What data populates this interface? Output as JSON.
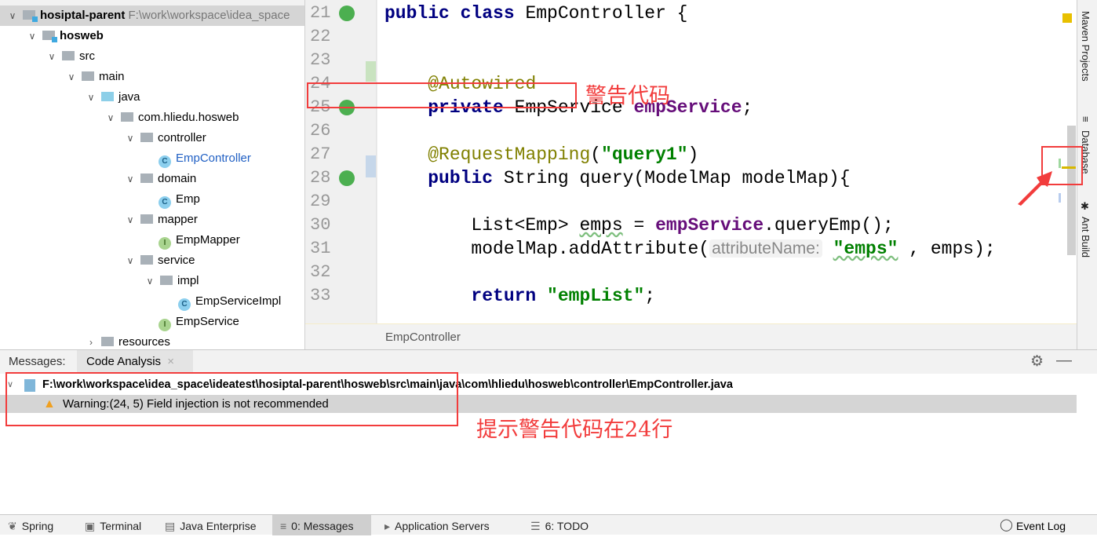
{
  "project": {
    "tree": [
      {
        "label": "hosiptal-parent",
        "path": "F:\\work\\workspace\\idea_space",
        "level": 0,
        "icon": "module-folder-icon",
        "bold": true,
        "selected": true,
        "open": true
      },
      {
        "label": "hosweb",
        "level": 1,
        "icon": "module-folder-icon",
        "bold": true,
        "open": true
      },
      {
        "label": "src",
        "level": 2,
        "icon": "folder-icon",
        "open": true
      },
      {
        "label": "main",
        "level": 3,
        "icon": "folder-icon",
        "open": true
      },
      {
        "label": "java",
        "level": 4,
        "icon": "source-folder-icon",
        "open": true
      },
      {
        "label": "com.hliedu.hosweb",
        "level": 5,
        "icon": "package-icon",
        "open": true
      },
      {
        "label": "controller",
        "level": 6,
        "icon": "package-icon",
        "open": true
      },
      {
        "label": "EmpController",
        "level": 7,
        "icon": "class-icon",
        "link": true
      },
      {
        "label": "domain",
        "level": 6,
        "icon": "package-icon",
        "open": true
      },
      {
        "label": "Emp",
        "level": 7,
        "icon": "class-icon"
      },
      {
        "label": "mapper",
        "level": 6,
        "icon": "package-icon",
        "open": true
      },
      {
        "label": "EmpMapper",
        "level": 7,
        "icon": "interface-icon"
      },
      {
        "label": "service",
        "level": 6,
        "icon": "package-icon",
        "open": true
      },
      {
        "label": "impl",
        "level": 7,
        "icon": "package-icon",
        "open": true
      },
      {
        "label": "EmpServiceImpl",
        "level": 8,
        "icon": "class-icon"
      },
      {
        "label": "EmpService",
        "level": 7,
        "icon": "interface-icon"
      },
      {
        "label": "resources",
        "level": 4,
        "icon": "folder-icon",
        "open": false
      }
    ]
  },
  "editor": {
    "lines": [
      {
        "n": "21",
        "tokens": [
          [
            "public ",
            "kw"
          ],
          [
            "class ",
            "kw"
          ],
          [
            "EmpController {",
            ""
          ]
        ],
        "gutter": "class-bean-icon"
      },
      {
        "n": "22",
        "tokens": []
      },
      {
        "n": "23",
        "tokens": []
      },
      {
        "n": "24",
        "tokens": [
          [
            "    ",
            ""
          ],
          [
            "@Autowired",
            "ann"
          ]
        ]
      },
      {
        "n": "25",
        "tokens": [
          [
            "    ",
            ""
          ],
          [
            "private ",
            "kw"
          ],
          [
            "EmpService ",
            ""
          ],
          [
            "empService",
            "fld"
          ],
          [
            ";",
            ""
          ]
        ],
        "gutter": "autowired-bean-icon"
      },
      {
        "n": "26",
        "tokens": []
      },
      {
        "n": "27",
        "tokens": [
          [
            "    ",
            ""
          ],
          [
            "@RequestMapping",
            "ann"
          ],
          [
            "(",
            ""
          ],
          [
            "\"query1\"",
            "str"
          ],
          [
            ")",
            ""
          ]
        ]
      },
      {
        "n": "28",
        "tokens": [
          [
            "    ",
            ""
          ],
          [
            "public ",
            "kw"
          ],
          [
            "String query(ModelMap modelMap){",
            ""
          ]
        ],
        "gutter": "request-mapping-icon"
      },
      {
        "n": "29",
        "tokens": []
      },
      {
        "n": "30",
        "tokens": [
          [
            "        List<Emp> ",
            ""
          ],
          [
            "emps",
            "squig"
          ],
          [
            " = ",
            ""
          ],
          [
            "empService",
            "fld"
          ],
          [
            ".queryEmp();",
            ""
          ]
        ]
      },
      {
        "n": "31",
        "tokens": [
          [
            "        modelMap.addAttribute(",
            ""
          ],
          [
            "attributeName:",
            "hint"
          ],
          [
            " ",
            ""
          ],
          [
            "\"emps\"",
            "str squig"
          ],
          [
            " , emps);",
            ""
          ]
        ]
      },
      {
        "n": "32",
        "tokens": []
      },
      {
        "n": "33",
        "tokens": [
          [
            "        ",
            ""
          ],
          [
            "return ",
            "kw"
          ],
          [
            "\"empList\"",
            "str"
          ],
          [
            ";",
            ""
          ]
        ]
      }
    ],
    "breadcrumb": "EmpController"
  },
  "right_tools": [
    "Maven Projects",
    "Database",
    "Ant Build"
  ],
  "messages": {
    "label": "Messages:",
    "tab": "Code Analysis",
    "file": "F:\\work\\workspace\\idea_space\\ideatest\\hosiptal-parent\\hosweb\\src\\main\\java\\com\\hliedu\\hosweb\\controller\\EmpController.java",
    "warning": "Warning:(24, 5)  Field injection is not recommended"
  },
  "status_tabs": [
    {
      "label": "Spring",
      "icon": "spring-icon"
    },
    {
      "label": "Terminal",
      "icon": "terminal-icon"
    },
    {
      "label": "Java Enterprise",
      "icon": "java-enterprise-icon"
    },
    {
      "label": "0: Messages",
      "icon": "messages-icon",
      "active": true
    },
    {
      "label": "Application Servers",
      "icon": "app-servers-icon"
    },
    {
      "label": "6: TODO",
      "icon": "todo-icon"
    }
  ],
  "event_log": "Event Log",
  "annotations": {
    "code_note": "警告代码",
    "panel_note": "提示警告代码在24行"
  },
  "colors": {
    "annotation": "#f23c3c",
    "keyword": "#000080",
    "string": "#008000",
    "field": "#660e7a"
  }
}
